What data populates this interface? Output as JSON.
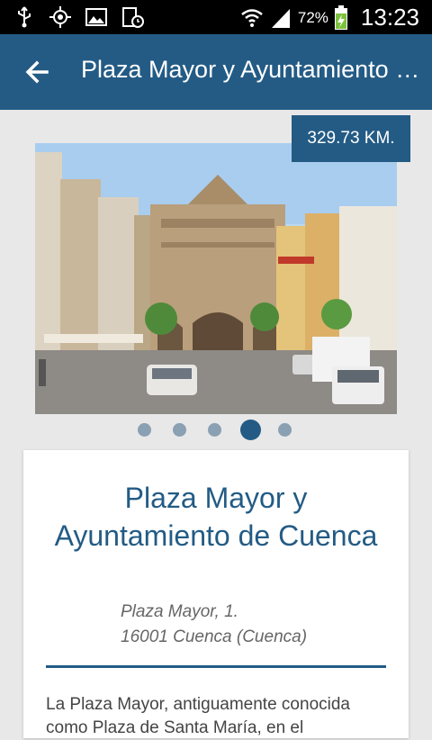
{
  "status_bar": {
    "battery_percent": "72%",
    "time": "13:23",
    "icons": [
      "usb-icon",
      "gps-icon",
      "image-icon",
      "screenshot-icon",
      "wifi-icon",
      "signal-icon",
      "battery-charging-icon"
    ]
  },
  "app_bar": {
    "title": "Plaza Mayor y Ayuntamiento de Cuenca",
    "back_icon": "arrow-back-icon"
  },
  "distance": "329.73 KM.",
  "gallery": {
    "image_count": 5,
    "active_index": 3
  },
  "card": {
    "title": "Plaza Mayor y Ayuntamiento de Cuenca",
    "address_line1": "Plaza Mayor, 1.",
    "address_line2": "16001 Cuenca (Cuenca)",
    "description": "La Plaza Mayor, antiguamente conocida como Plaza de Santa María, en el"
  },
  "colors": {
    "primary": "#235b85",
    "background": "#e8e8e8",
    "dot_inactive": "#8aa0b3"
  }
}
